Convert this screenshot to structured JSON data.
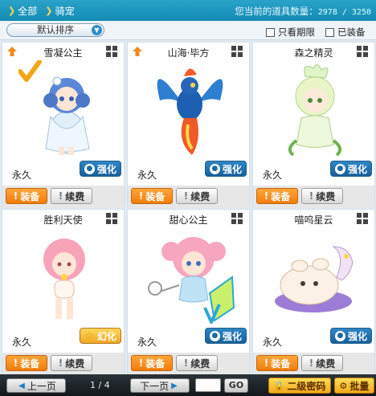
{
  "topbar": {
    "nav": [
      {
        "label": "全部",
        "active": true
      },
      {
        "label": "骑宠",
        "active": false
      }
    ],
    "count_label": "您当前的道具数量：",
    "count_value": "2978 / 3250"
  },
  "filters": {
    "sort_value": "默认排序",
    "only_expiring": "只看期限",
    "equipped": "已装备"
  },
  "cards": [
    {
      "name": "雪凝公主",
      "expire": "永久",
      "tag": "强化",
      "tag_style": "blue",
      "pinned": true,
      "checked": true
    },
    {
      "name": "山海·毕方",
      "expire": "永久",
      "tag": "强化",
      "tag_style": "blue",
      "pinned": true,
      "checked": false
    },
    {
      "name": "森之精灵",
      "expire": "永久",
      "tag": "强化",
      "tag_style": "blue",
      "pinned": false,
      "checked": false
    },
    {
      "name": "胜利天使",
      "expire": "永久",
      "tag": "幻化",
      "tag_style": "gold",
      "pinned": false,
      "checked": false
    },
    {
      "name": "甜心公主",
      "expire": "永久",
      "tag": "强化",
      "tag_style": "blue",
      "pinned": false,
      "checked": false
    },
    {
      "name": "喵呜星云",
      "expire": "永久",
      "tag": "强化",
      "tag_style": "blue",
      "pinned": false,
      "checked": false
    }
  ],
  "buttons": {
    "equip": "装备",
    "renew": "续费"
  },
  "pagination": {
    "prev": "上一页",
    "page_info": "1 / 4",
    "next": "下一页",
    "go": "GO"
  },
  "bottom_actions": {
    "password": "二级密码",
    "batch": "批量"
  },
  "colors": {
    "topbar": "#1a96bf",
    "equip": "#f58a15",
    "tag_blue": "#1f6fad",
    "tag_gold": "#f0a621"
  }
}
